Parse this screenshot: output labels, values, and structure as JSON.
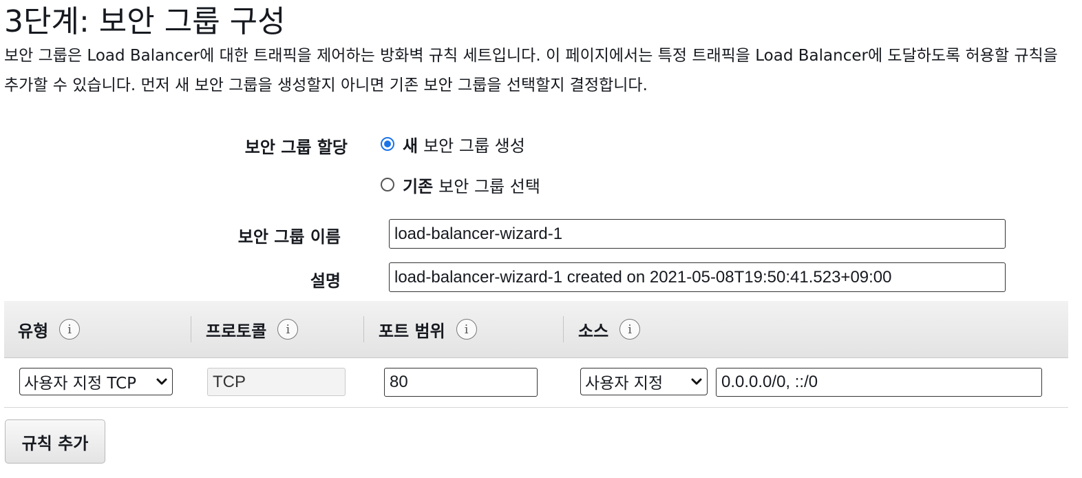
{
  "page": {
    "title": "3단계: 보안 그룹 구성",
    "description": "보안 그룹은 Load Balancer에 대한 트래픽을 제어하는 방화벽 규칙 세트입니다. 이 페이지에서는 특정 트래픽을 Load Balancer에 도달하도록 허용할 규칙을 추가할 수 있습니다. 먼저 새 보안 그룹을 생성할지 아니면 기존 보안 그룹을 선택할지 결정합니다."
  },
  "assignment": {
    "label": "보안 그룹 할당",
    "options": [
      {
        "bold": "새",
        "rest": "보안 그룹 생성",
        "checked": true
      },
      {
        "bold": "기존",
        "rest": "보안 그룹 선택",
        "checked": false
      }
    ]
  },
  "name_field": {
    "label": "보안 그룹 이름",
    "value": "load-balancer-wizard-1"
  },
  "description_field": {
    "label": "설명",
    "value": "load-balancer-wizard-1 created on 2021-05-08T19:50:41.523+09:00"
  },
  "rules_table": {
    "columns": [
      "유형",
      "프로토콜",
      "포트 범위",
      "소스"
    ],
    "info_glyph": "i",
    "rows": [
      {
        "type": "사용자 지정 TCP",
        "protocol": "TCP",
        "port_range": "80",
        "source_type": "사용자 지정",
        "source_value": "0.0.0.0/0, ::/0"
      }
    ]
  },
  "add_rule_label": "규칙 추가",
  "colors": {
    "radio_accent": "#1a73e8",
    "header_bg": "#e8e8e8"
  },
  "icons": {
    "info": "info-circle-icon",
    "dropdown": "chevron-down-icon",
    "radio_checked": "radio-checked-icon",
    "radio_unchecked": "radio-unchecked-icon"
  }
}
